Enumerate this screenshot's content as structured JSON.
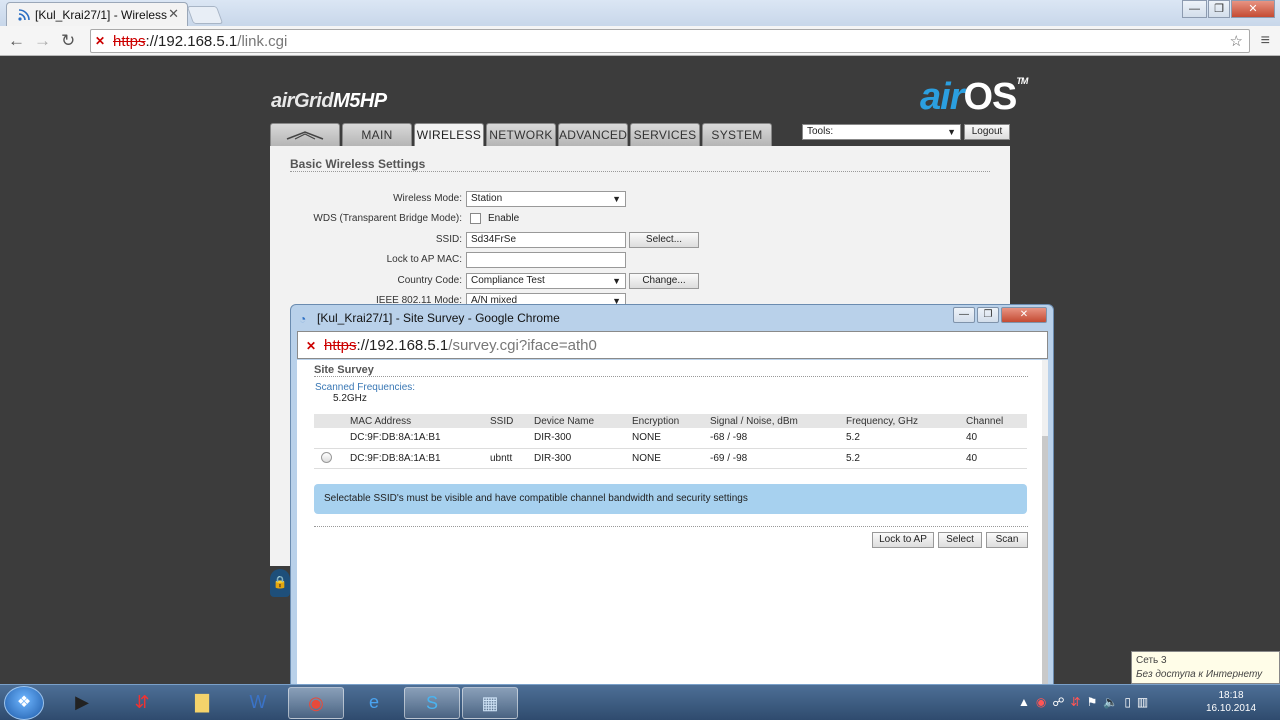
{
  "browser": {
    "tab_title": "[Kul_Krai27/1] - Wireless",
    "tab_close": "✕",
    "url_scheme": "https",
    "url_host": "://192.168.5.1",
    "url_path": "/link.cgi",
    "window_controls": [
      "—",
      "❐",
      "✕"
    ]
  },
  "page": {
    "brand_left": "airGrid",
    "brand_model": "M5HP",
    "brand_right_air": "air",
    "brand_right_os": "OS",
    "brand_tm": "TM",
    "nav_tabs": [
      "",
      "MAIN",
      "WIRELESS",
      "NETWORK",
      "ADVANCED",
      "SERVICES",
      "SYSTEM"
    ],
    "active_tab": "WIRELESS",
    "tools_label": "Tools:",
    "logout_label": "Logout",
    "section_title": "Basic Wireless Settings",
    "fields": {
      "wireless_mode_label": "Wireless Mode:",
      "wireless_mode_value": "Station",
      "wds_label": "WDS (Transparent Bridge Mode):",
      "wds_enable_label": "Enable",
      "ssid_label": "SSID:",
      "ssid_value": "Sd34FrSe",
      "ssid_select_button": "Select...",
      "lock_ap_label": "Lock to AP MAC:",
      "lock_ap_value": "",
      "country_label": "Country Code:",
      "country_value": "Compliance Test",
      "country_change_button": "Change...",
      "ieee_label": "IEEE 802.11 Mode:",
      "ieee_value": "A/N mixed"
    }
  },
  "popup": {
    "title": "[Kul_Krai27/1] - Site Survey - Google Chrome",
    "url_scheme": "https",
    "url_host": "://192.168.5.1",
    "url_path": "/survey.cgi?iface=ath0",
    "heading": "Site Survey",
    "scanned_label": "Scanned Frequencies:",
    "scanned_value": "5.2GHz",
    "columns": [
      "",
      "MAC Address",
      "SSID",
      "Device Name",
      "Encryption",
      "Signal / Noise, dBm",
      "Frequency, GHz",
      "Channel"
    ],
    "rows": [
      {
        "mac": "DC:9F:DB:8A:1A:B1",
        "ssid": "",
        "device": "DIR-300",
        "encryption": "NONE",
        "signal": "-68 / -98",
        "frequency": "5.2",
        "channel": "40",
        "selectable": false
      },
      {
        "mac": "DC:9F:DB:8A:1A:B1",
        "ssid": "ubntt",
        "device": "DIR-300",
        "encryption": "NONE",
        "signal": "-69 / -98",
        "frequency": "5.2",
        "channel": "40",
        "selectable": true
      }
    ],
    "note": "Selectable SSID's must be visible and have compatible channel bandwidth and security settings",
    "buttons": {
      "lock": "Lock to AP",
      "select": "Select",
      "scan": "Scan"
    }
  },
  "network_tooltip": {
    "line1": "Сеть  3",
    "line2": "Без доступа к Интернету"
  },
  "taskbar": {
    "time": "18:18",
    "date": "16.10.2014"
  }
}
